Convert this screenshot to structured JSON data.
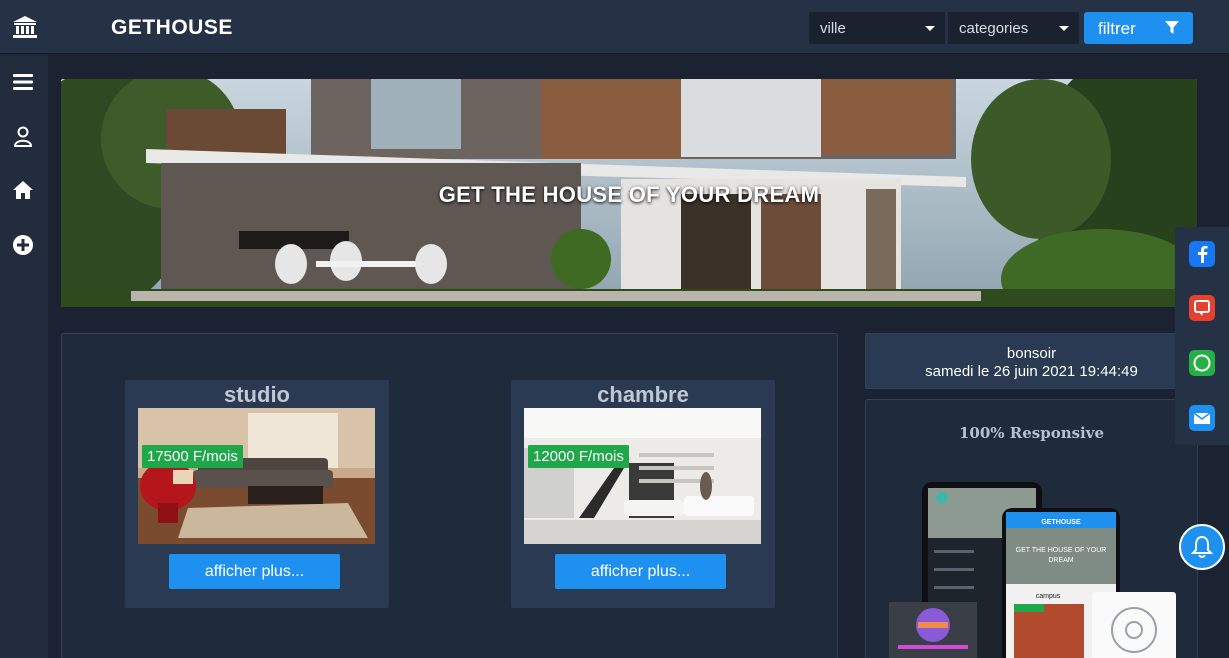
{
  "header": {
    "brand": "GETHOUSE",
    "city_select": "ville",
    "category_select": "categories",
    "filter_label": "filtrer"
  },
  "sidebar": {
    "items": [
      {
        "icon": "menu-icon"
      },
      {
        "icon": "user-icon"
      },
      {
        "icon": "home-icon"
      },
      {
        "icon": "add-circle-icon"
      }
    ]
  },
  "hero": {
    "tagline": "GET THE HOUSE OF YOUR DREAM"
  },
  "listings": [
    {
      "title": "studio",
      "price": "17500 F/mois",
      "button": "afficher plus..."
    },
    {
      "title": "chambre",
      "price": "12000 F/mois",
      "button": "afficher plus..."
    }
  ],
  "greeting": {
    "message": "bonsoir",
    "datetime": "samedi le 26 juin 2021 19:44:49"
  },
  "promo": {
    "title": "100% Responsive",
    "phone_brand": "GETHOUSE",
    "phone_tagline_1": "GET THE HOUSE OF YOUR",
    "phone_tagline_2": "DREAM",
    "phone_card": "campus"
  },
  "social": [
    "facebook-icon",
    "chat-icon",
    "whatsapp-icon",
    "mail-icon"
  ],
  "colors": {
    "accent": "#1e90f0",
    "price_badge": "#1ea84a",
    "topbar": "#253246",
    "background": "#1b2332"
  }
}
